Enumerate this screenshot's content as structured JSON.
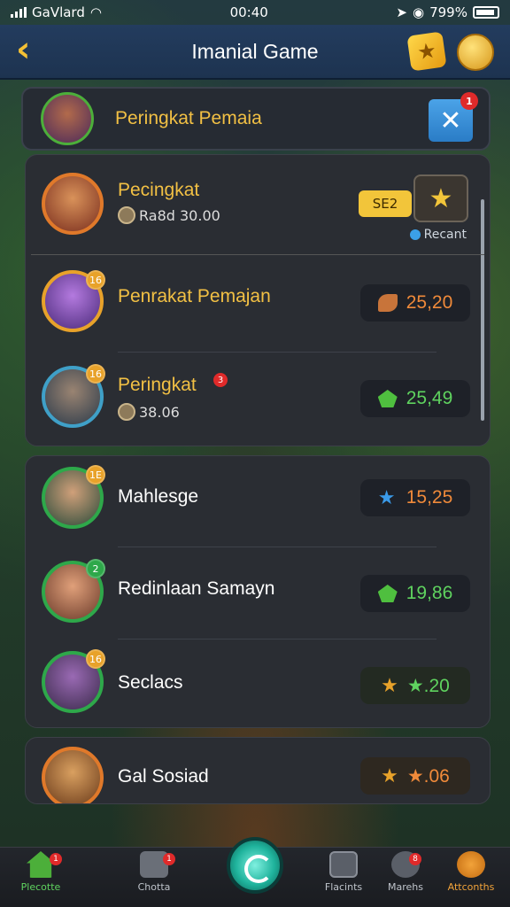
{
  "status_bar": {
    "carrier": "GaVlard",
    "time": "00:40",
    "battery": "799%"
  },
  "header": {
    "title": "Imanial Game"
  },
  "panel": {
    "title": "Peringkat Pemaia",
    "close_badge": "1"
  },
  "group1": {
    "rows": [
      {
        "name": "Pecingkat",
        "sub": "Ra8d 30.00",
        "pill": "SE2",
        "recent": "Recant"
      },
      {
        "name": "Penrakat Pemajan",
        "score": "25,20",
        "level": "16"
      },
      {
        "name": "Peringkat",
        "sub": "38.06",
        "score": "25,49",
        "level": "16",
        "badge": "3"
      }
    ]
  },
  "group2": {
    "rows": [
      {
        "name": "Mahlesge",
        "score": "15,25",
        "level": "1E"
      },
      {
        "name": "Redinlaan Samayn",
        "score": "19,86",
        "level": "2"
      },
      {
        "name": "Seclacs",
        "score": "★.20",
        "level": "16"
      }
    ]
  },
  "group3": {
    "rows": [
      {
        "name": "Gal Sosiad",
        "score": "★.06"
      }
    ]
  },
  "nav": {
    "items": [
      {
        "label": "Plecotte",
        "badge": "1"
      },
      {
        "label": "Chotta",
        "badge": "1"
      },
      {
        "label": "Flacints"
      },
      {
        "label": "Marehs",
        "badge": "8"
      },
      {
        "label": "Attconths"
      }
    ]
  },
  "colors": {
    "gold": "#f2c044",
    "orange": "#f08a3a",
    "green": "#5fd35f",
    "accent_blue": "#2a7cc6"
  }
}
